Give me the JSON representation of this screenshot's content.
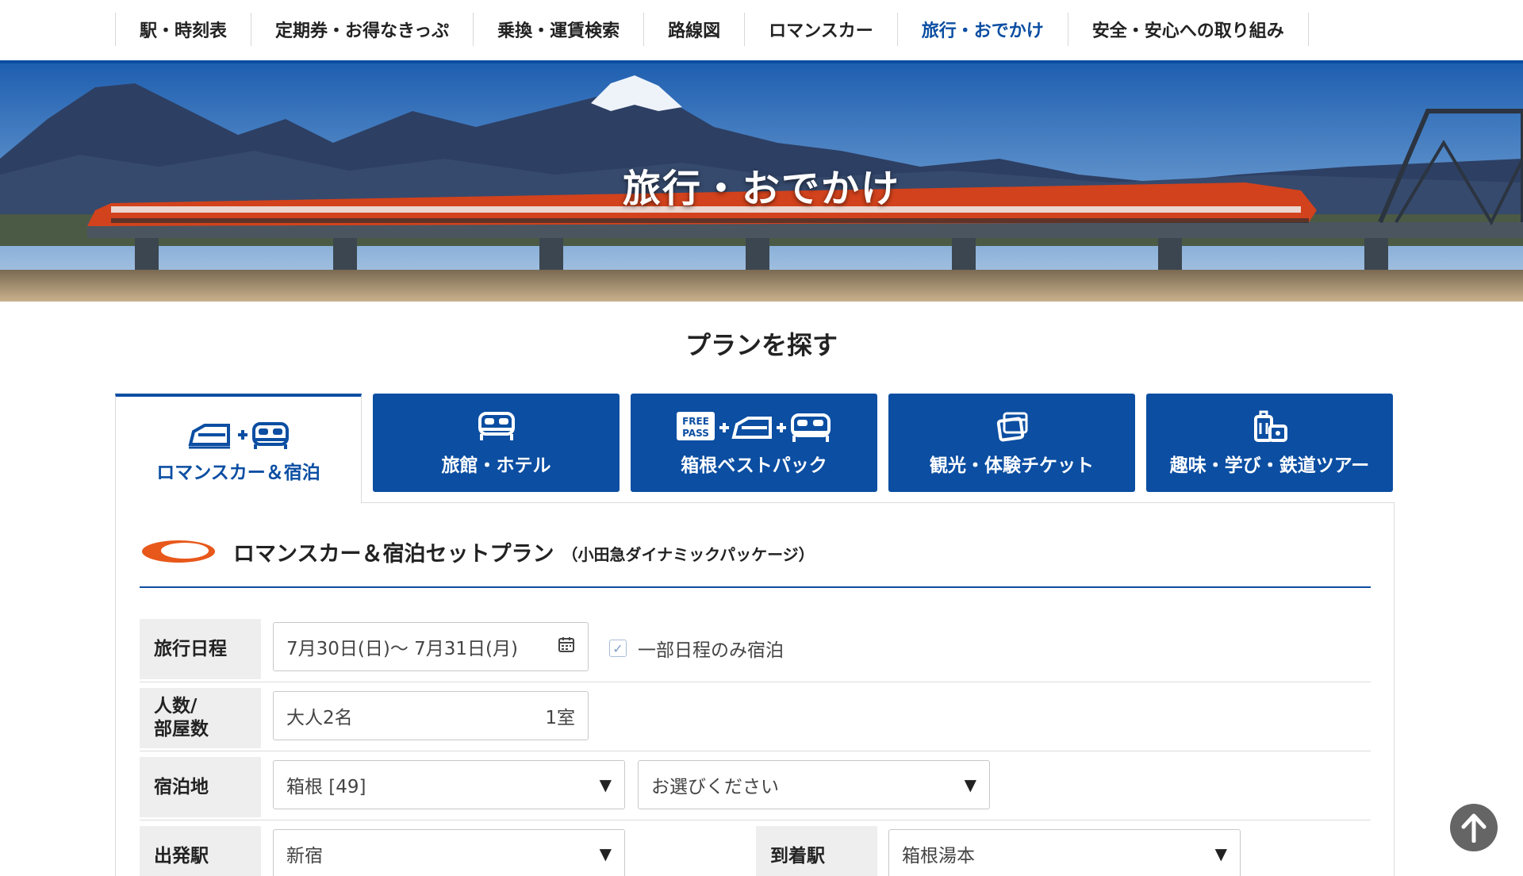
{
  "nav": {
    "items": [
      {
        "label": "駅・時刻表",
        "active": false
      },
      {
        "label": "定期券・お得なきっぷ",
        "active": false
      },
      {
        "label": "乗換・運賃検索",
        "active": false
      },
      {
        "label": "路線図",
        "active": false
      },
      {
        "label": "ロマンスカー",
        "active": false
      },
      {
        "label": "旅行・おでかけ",
        "active": true
      },
      {
        "label": "安全・安心への取り組み",
        "active": false
      }
    ]
  },
  "hero": {
    "title": "旅行・おでかけ"
  },
  "section": {
    "title": "プランを探す"
  },
  "tabs": [
    {
      "label": "ロマンスカー＆宿泊",
      "icon": "train-plus-bed-icon",
      "active": true
    },
    {
      "label": "旅館・ホテル",
      "icon": "bed-icon",
      "active": false
    },
    {
      "label": "箱根ベストパック",
      "icon": "freepass-train-bed-icon",
      "active": false,
      "badge_line1": "FREE",
      "badge_line2": "PASS"
    },
    {
      "label": "観光・体験チケット",
      "icon": "tickets-icon",
      "active": false
    },
    {
      "label": "趣味・学び・鉄道ツアー",
      "icon": "luggage-icon",
      "active": false
    }
  ],
  "panel": {
    "title": "ロマンスカー＆宿泊セットプラン",
    "subtitle": "（小田急ダイナミックパッケージ）",
    "brand_color": "#e8581a",
    "accent_color": "#0b4ea2"
  },
  "form": {
    "dates": {
      "label": "旅行日程",
      "value": "7月30日(日)〜 7月31日(月)",
      "partial_stay_label": "一部日程のみ宿泊",
      "partial_stay_checked": false
    },
    "people": {
      "label_line1": "人数/",
      "label_line2": "部屋数",
      "adults": "大人2名",
      "rooms": "1室"
    },
    "destination": {
      "label": "宿泊地",
      "area": "箱根 [49]",
      "subarea": "お選びください"
    },
    "departure": {
      "label": "出発駅",
      "value": "新宿"
    },
    "arrival": {
      "label": "到着駅",
      "value": "箱根湯本"
    }
  }
}
